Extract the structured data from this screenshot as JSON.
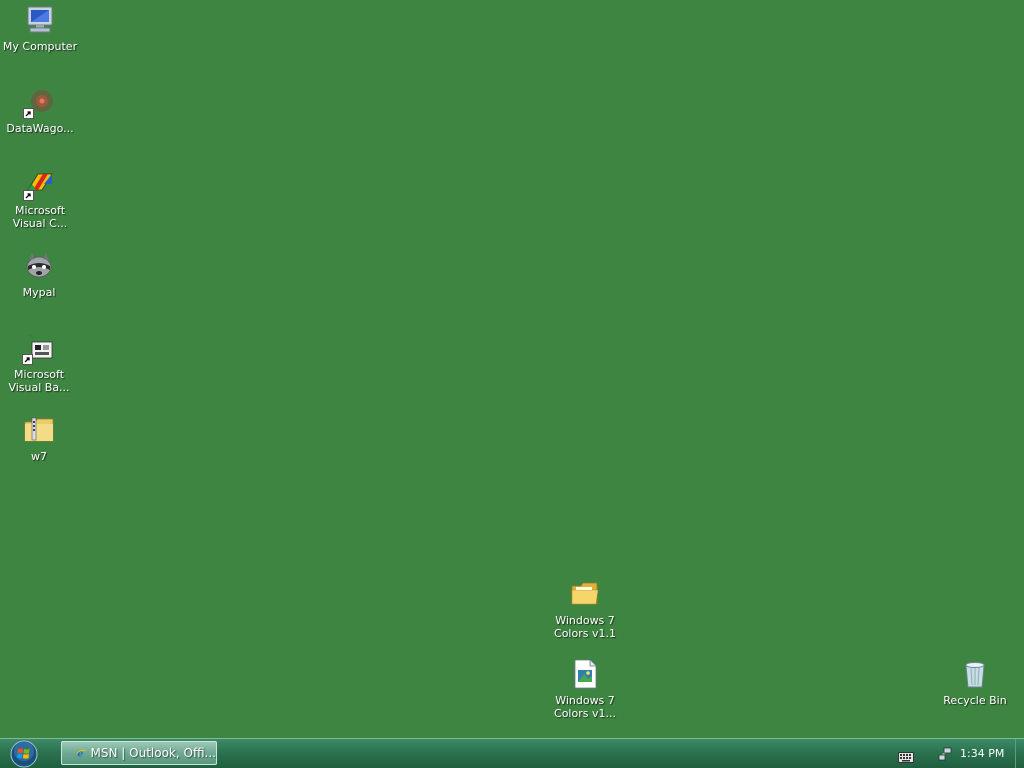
{
  "desktop": {
    "background_color": "#3f8542",
    "icons": [
      {
        "label": "My Computer",
        "icon": "computer-icon"
      },
      {
        "label": "DataWago...",
        "icon": "datawagon-icon"
      },
      {
        "label": "Microsoft\nVisual C...",
        "icon": "visual-cpp-icon"
      },
      {
        "label": "Mypal",
        "icon": "mypal-browser-icon"
      },
      {
        "label": "Microsoft\nVisual Ba...",
        "icon": "visual-basic-icon"
      },
      {
        "label": "w7",
        "icon": "zip-folder-icon"
      },
      {
        "label": "Windows 7\nColors v1.1",
        "icon": "folder-icon"
      },
      {
        "label": "Windows 7\nColors v1...",
        "icon": "document-icon"
      },
      {
        "label": "Recycle Bin",
        "icon": "recycle-bin-icon"
      }
    ]
  },
  "taskbar": {
    "start_icon": "windows-orb-icon",
    "tasks": [
      {
        "label": "MSN | Outlook, Offi...",
        "icon": "internet-explorer-icon"
      }
    ],
    "tray": {
      "keyboard_icon": "keyboard-icon",
      "network_icon": "network-icon",
      "clock": "1:34 PM"
    }
  }
}
